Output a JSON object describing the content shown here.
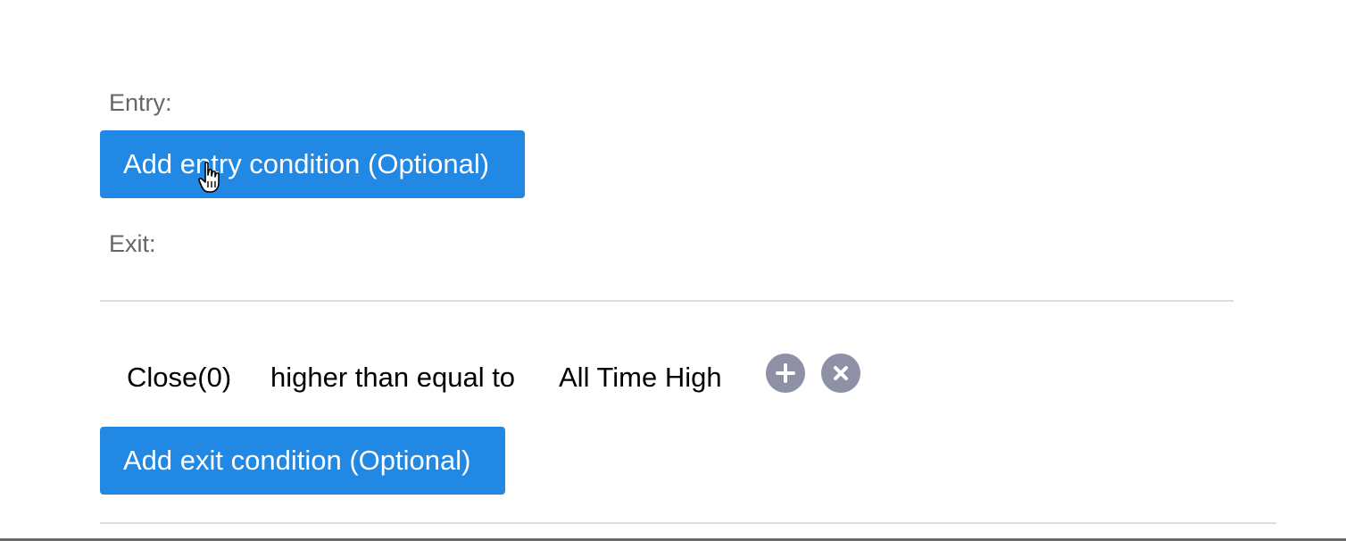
{
  "entry": {
    "label": "Entry:",
    "add_button_label": "Add entry condition (Optional)"
  },
  "exit": {
    "label": "Exit:",
    "conditions": [
      {
        "left_operand": "Close(0)",
        "operator": "higher than equal to",
        "right_operand": "All Time High",
        "add_icon": "plus-icon",
        "remove_icon": "close-icon"
      }
    ],
    "add_button_label": "Add exit condition (Optional)"
  },
  "colors": {
    "primary_button": "#2188e4",
    "icon_button": "#8e91a6",
    "label_text": "#666666"
  }
}
